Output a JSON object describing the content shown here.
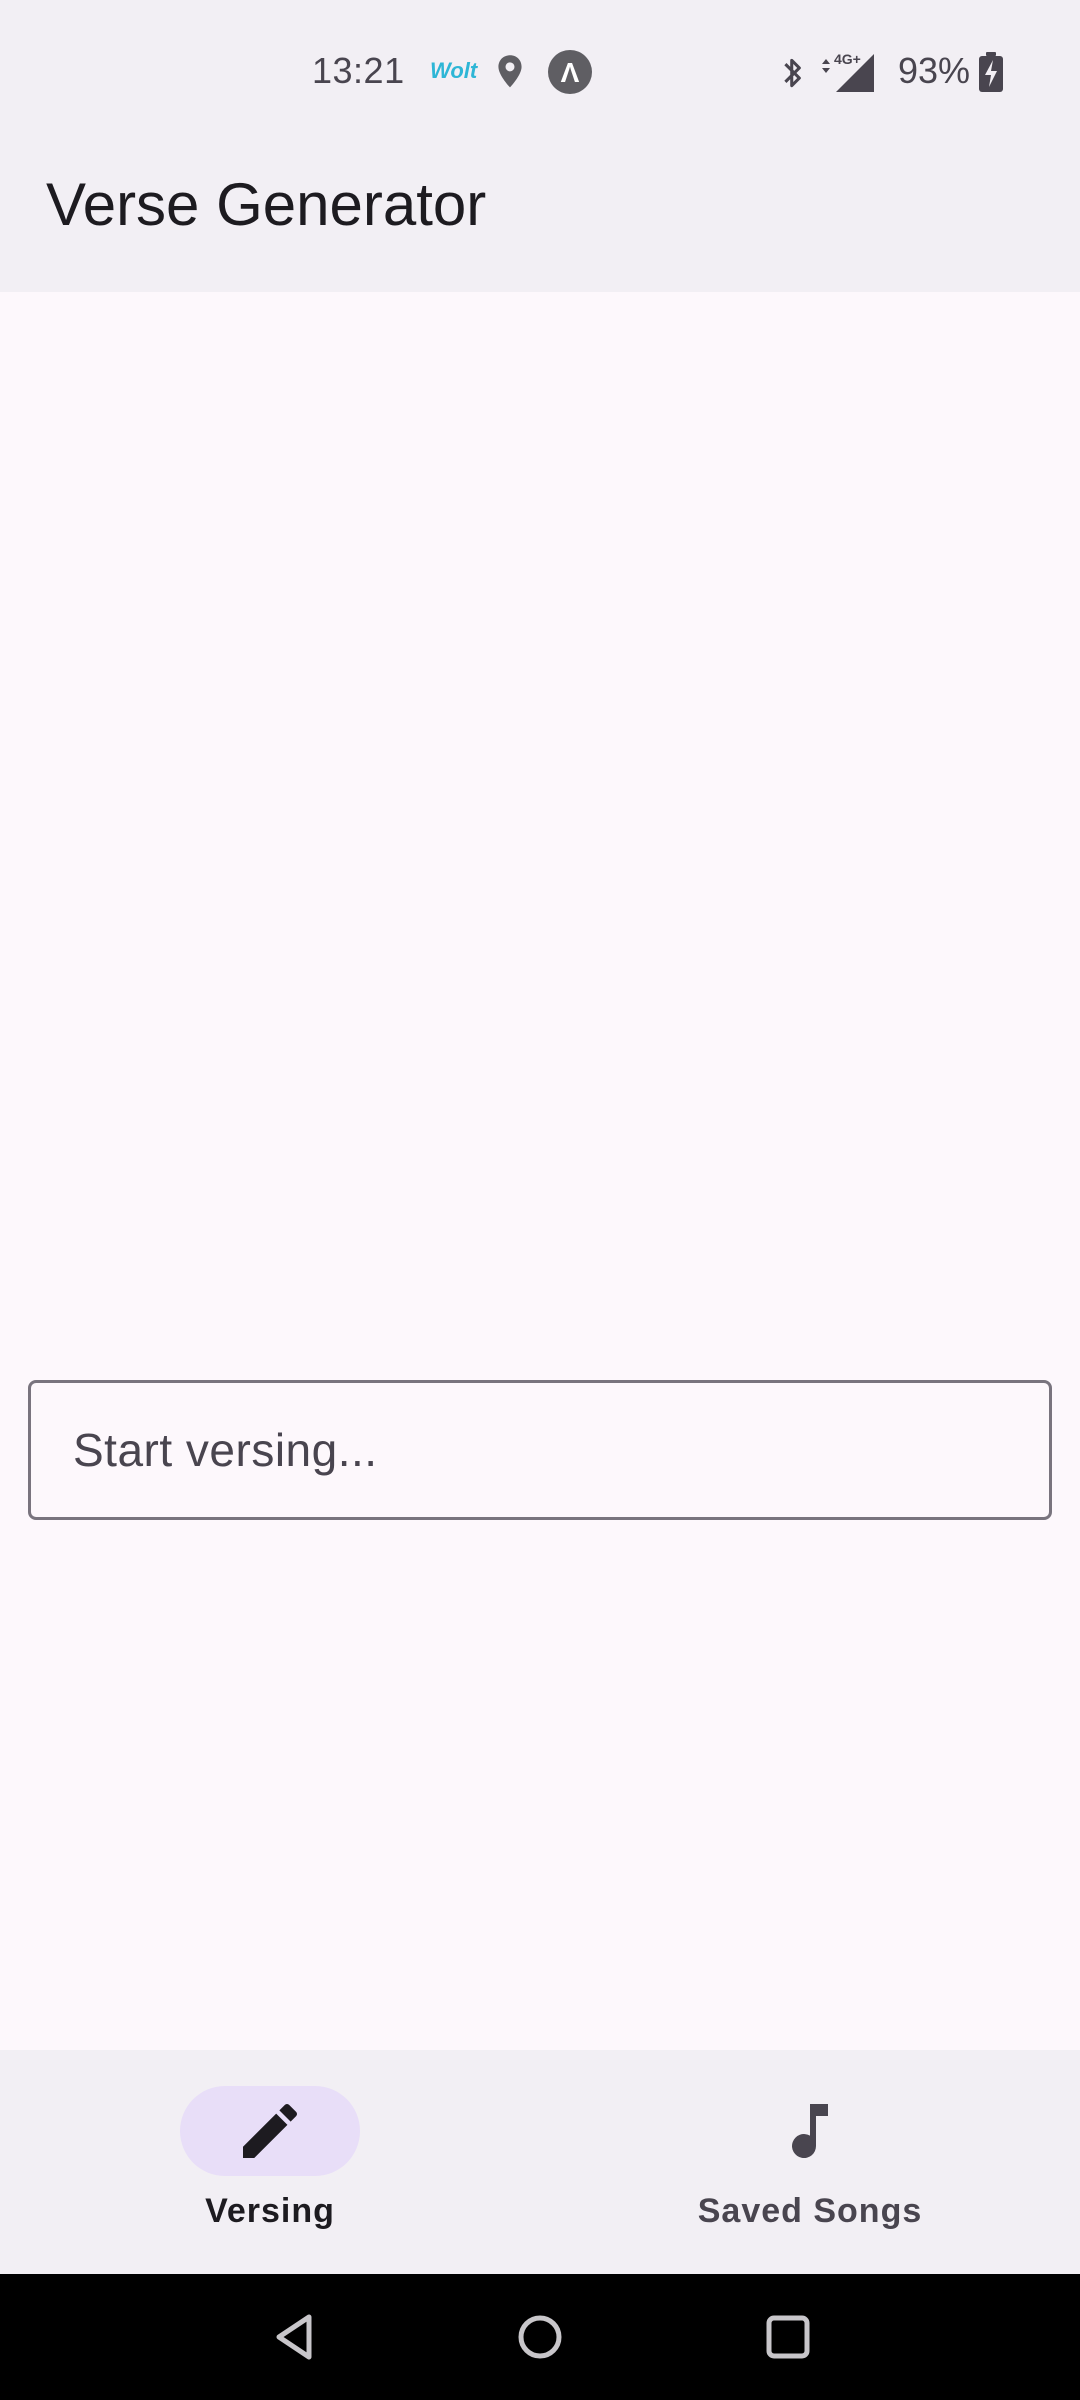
{
  "status_bar": {
    "time": "13:21",
    "wolt_label": "Wolt",
    "app_badge": "Λ",
    "battery_percent": "93%",
    "network": "4G+",
    "icons": [
      "wolt-icon",
      "location-icon",
      "app-notification-icon",
      "bluetooth-icon",
      "mobile-data-icon",
      "battery-charging-icon"
    ]
  },
  "app_bar": {
    "title": "Verse Generator"
  },
  "main": {
    "input_placeholder": "Start versing...",
    "input_value": ""
  },
  "bottom_nav": {
    "items": [
      {
        "label": "Versing",
        "icon": "pencil-icon",
        "active": true
      },
      {
        "label": "Saved Songs",
        "icon": "music-note-icon",
        "active": false
      }
    ]
  },
  "system_nav": {
    "icons": [
      "back-icon",
      "home-icon",
      "recents-icon"
    ]
  },
  "colors": {
    "background": "#fdf8fc",
    "bar_surface": "#f2eff4",
    "active_indicator": "#e8def8",
    "text_primary": "#1d1b20",
    "text_secondary": "#49454f",
    "outline": "#79747e"
  }
}
